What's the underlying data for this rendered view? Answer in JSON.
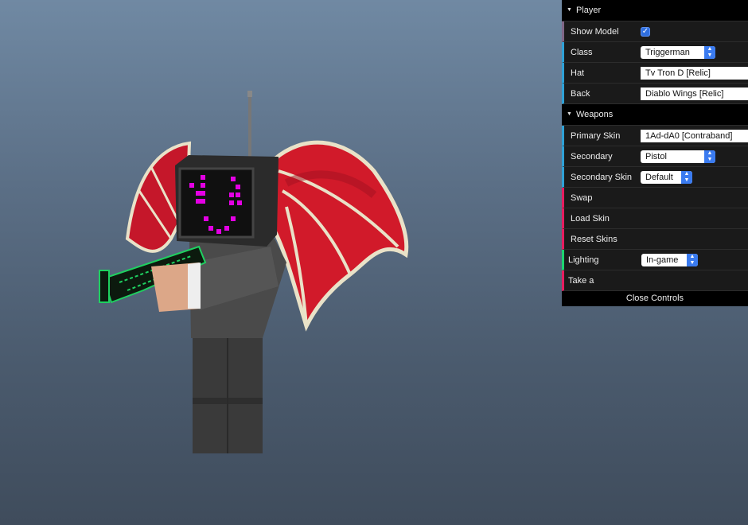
{
  "gui": {
    "player_folder": "Player",
    "show_model": {
      "label": "Show Model",
      "checked": true
    },
    "class": {
      "label": "Class",
      "value": "Triggerman"
    },
    "hat": {
      "label": "Hat",
      "value": "Tv Tron D [Relic]"
    },
    "back": {
      "label": "Back",
      "value": "Diablo Wings [Relic]"
    },
    "weapons_folder": "Weapons",
    "primary_skin": {
      "label": "Primary Skin",
      "value": "1Ad-dA0 [Contraband]"
    },
    "secondary": {
      "label": "Secondary",
      "value": "Pistol"
    },
    "secondary_skin": {
      "label": "Secondary Skin",
      "value": "Default"
    },
    "swap_label": "Swap",
    "load_skin_label": "Load Skin",
    "reset_skins_label": "Reset Skins",
    "lighting": {
      "label": "Lighting",
      "value": "In-game"
    },
    "take_label": "Take a",
    "close_label": "Close Controls"
  },
  "icons": {
    "folder_toggle": "triangle-down-icon",
    "check": "checkmark-icon",
    "stepper": "up-down-arrows-icon"
  },
  "colors": {
    "accent_blue": "#2fa1d6",
    "accent_function": "#e61d5f",
    "accent_boolean": "#806787",
    "accent_lighting": "#1ed36f",
    "face_pixels": "#e400e4",
    "wing_red": "#d11a2a"
  }
}
